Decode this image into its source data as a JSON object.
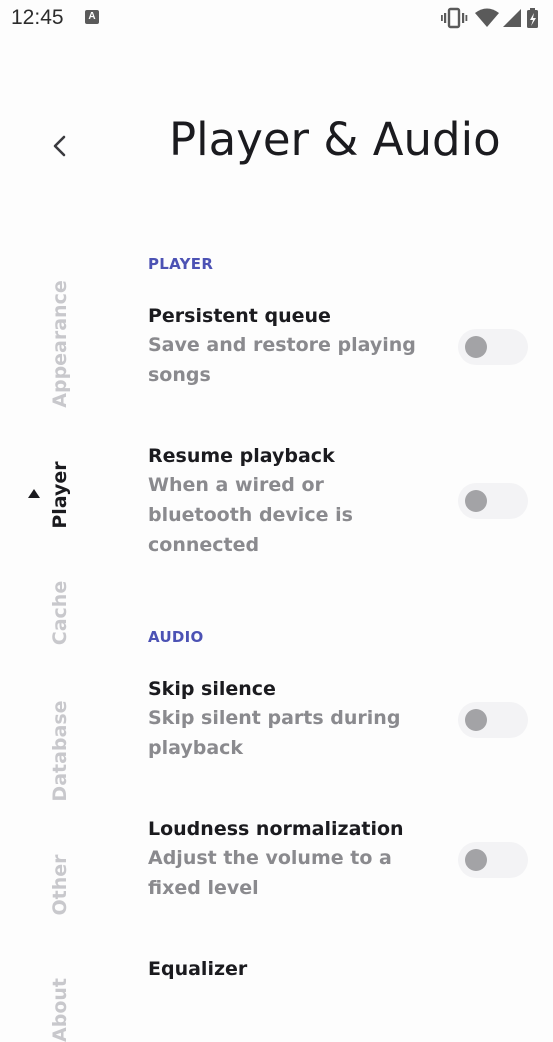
{
  "status_bar": {
    "time": "12:45",
    "notification_icon": "a-icon",
    "right_icons": [
      "vibrate-icon",
      "wifi-icon",
      "signal-icon",
      "battery-icon"
    ]
  },
  "header": {
    "back_icon": "chevron-left-icon",
    "title": "Player & Audio"
  },
  "tabs": [
    {
      "label": "Appearance",
      "active": false
    },
    {
      "label": "Player",
      "active": true
    },
    {
      "label": "Cache",
      "active": false
    },
    {
      "label": "Database",
      "active": false
    },
    {
      "label": "Other",
      "active": false
    },
    {
      "label": "About",
      "active": false
    }
  ],
  "sections": {
    "player": {
      "header": "PLAYER",
      "items": [
        {
          "title": "Persistent queue",
          "description": "Save and restore playing songs",
          "enabled": false
        },
        {
          "title": "Resume playback",
          "description": "When a wired or bluetooth device is connected",
          "enabled": false
        }
      ]
    },
    "audio": {
      "header": "AUDIO",
      "items": [
        {
          "title": "Skip silence",
          "description": "Skip silent parts during playback",
          "enabled": false
        },
        {
          "title": "Loudness normalization",
          "description": "Adjust the volume to a fixed level",
          "enabled": false
        },
        {
          "title": "Equalizer",
          "description": "",
          "enabled": false
        }
      ]
    }
  },
  "colors": {
    "accent": "#4c52b4",
    "text_primary": "#1b1b1f",
    "text_secondary": "#8a8a8e",
    "tab_inactive": "#c8c8cc",
    "toggle_track": "#f3f3f5",
    "toggle_thumb": "#a3a3a6",
    "background": "#fdfdfd"
  }
}
